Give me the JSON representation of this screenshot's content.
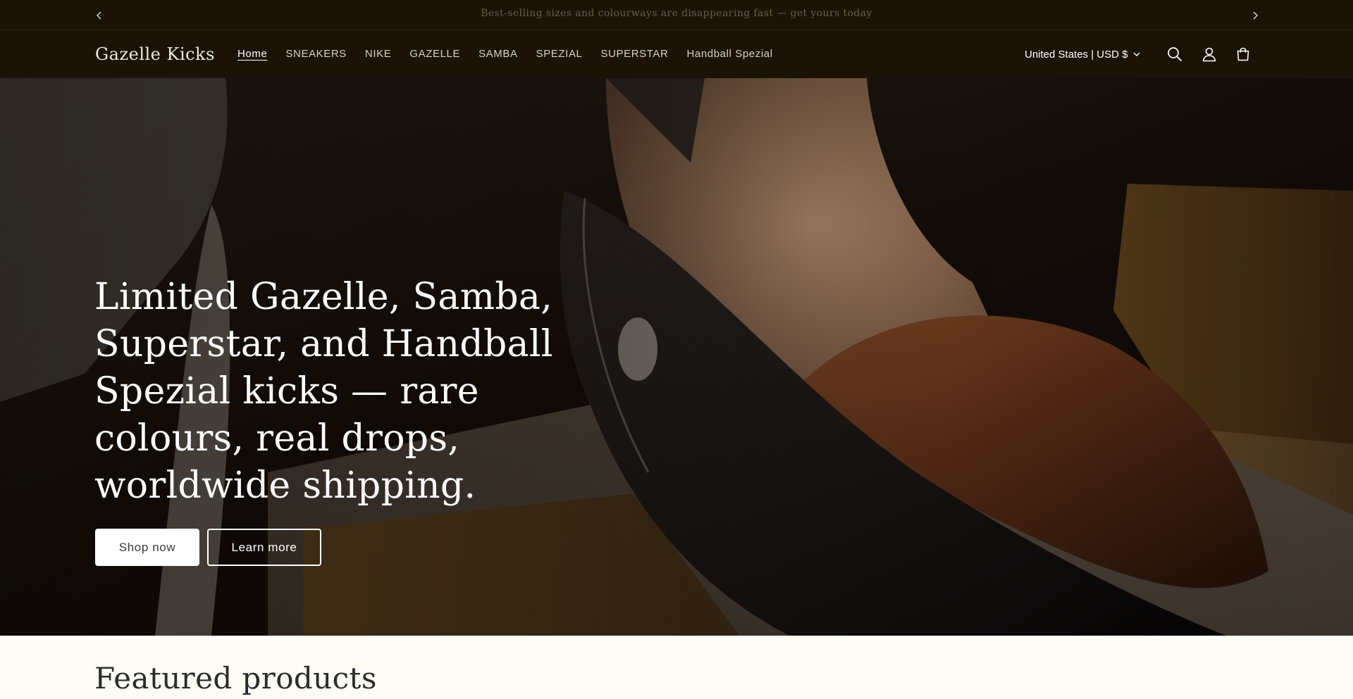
{
  "announcement": {
    "message": "Best-selling sizes and colourways are disappearing fast — get yours today",
    "prev_icon": "chevron-left-icon",
    "next_icon": "chevron-right-icon"
  },
  "header": {
    "logo": "Gazelle Kicks",
    "nav": [
      {
        "label": "Home",
        "active": true
      },
      {
        "label": "SNEAKERS"
      },
      {
        "label": "NIKE"
      },
      {
        "label": "GAZELLE"
      },
      {
        "label": "SAMBA"
      },
      {
        "label": "SPEZIAL"
      },
      {
        "label": "SUPERSTAR"
      },
      {
        "label": "Handball Spezial"
      }
    ],
    "locale": "United States | USD $",
    "icons": [
      "search-icon",
      "account-icon",
      "cart-icon"
    ]
  },
  "hero": {
    "title": "Limited Gazelle, Samba, Superstar, and Handball Spezial kicks — rare colours, real drops, worldwide shipping.",
    "primary_button": "Shop now",
    "secondary_button": "Learn more"
  },
  "featured": {
    "heading": "Featured products"
  },
  "colors": {
    "header_bg": "#1c1307",
    "page_bg": "#fdfcf5",
    "button_bg": "#ffffff"
  }
}
